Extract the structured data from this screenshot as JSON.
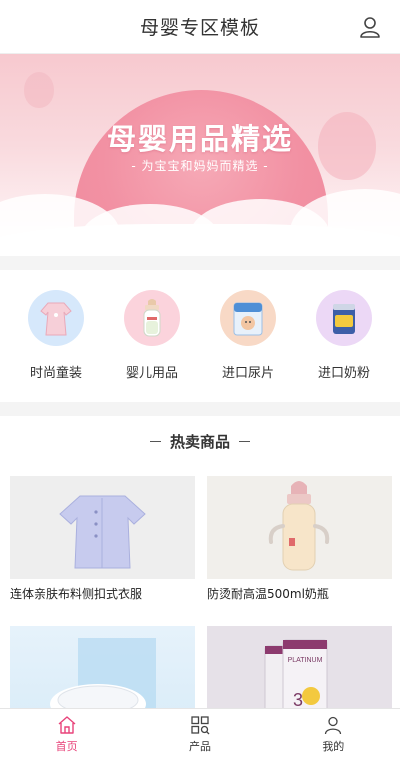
{
  "header": {
    "title": "母婴专区模板"
  },
  "banner": {
    "title": "母婴用品精选",
    "subtitle": "- 为宝宝和妈妈而精选 -"
  },
  "categories": [
    {
      "label": "时尚童装",
      "icon": "baby-dress-icon"
    },
    {
      "label": "婴儿用品",
      "icon": "baby-bottle-icon"
    },
    {
      "label": "进口尿片",
      "icon": "diaper-pack-icon"
    },
    {
      "label": "进口奶粉",
      "icon": "milk-powder-icon"
    }
  ],
  "section": {
    "title": "热卖商品"
  },
  "products": [
    {
      "title": "连体亲肤布料侧扣式衣服"
    },
    {
      "title": "防烫耐高温500ml奶瓶"
    },
    {
      "title": ""
    },
    {
      "title": ""
    }
  ],
  "product_image_text": {
    "can_top": "PLATINUM",
    "can_number": "3"
  },
  "tabbar": {
    "items": [
      {
        "label": "首页",
        "active": true
      },
      {
        "label": "产品",
        "active": false
      },
      {
        "label": "我的",
        "active": false
      }
    ]
  },
  "colors": {
    "accent": "#e8437a",
    "banner_pink": "#f291a3"
  }
}
